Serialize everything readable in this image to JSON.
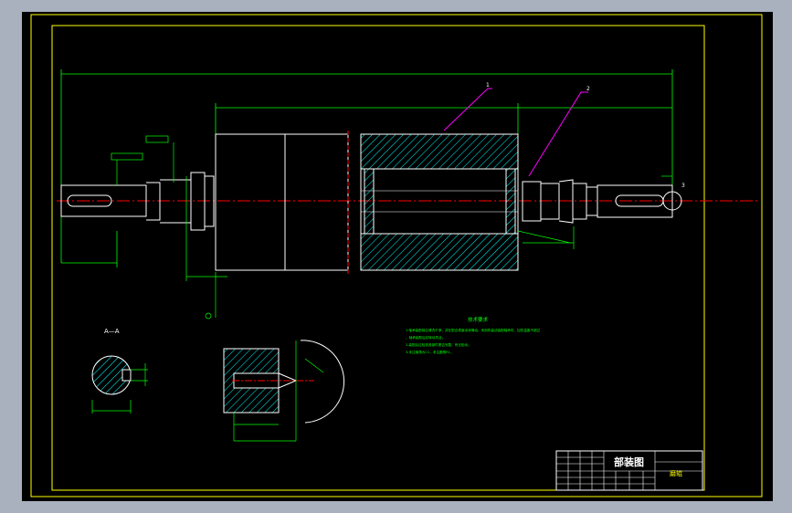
{
  "drawing": {
    "title_block": {
      "drawing_title": "部装图",
      "part_name": "磨辊"
    },
    "tech_requirements": {
      "heading": "技术要求",
      "items": [
        "1.轴承装配前应清洗干净，并在配合表面涂润滑油，采用热装法装配轴承时，加热温度不超过",
        "   ，轴承装配后应转动灵活；",
        "2.装配后应检查各部件是否完整，有无松动；",
        "3.未注倒角为C1，未注圆角R1。"
      ]
    },
    "section_label": "A—A",
    "balloons": [
      "1",
      "2",
      "3"
    ]
  },
  "colors": {
    "background": "#000000",
    "frame": "#ffff00",
    "outline": "#ffffff",
    "dimension": "#00ff00",
    "centerline": "#ff0000",
    "hatch": "#00ffff",
    "leader": "#ff00ff",
    "desktop": "#a9b1bf"
  }
}
